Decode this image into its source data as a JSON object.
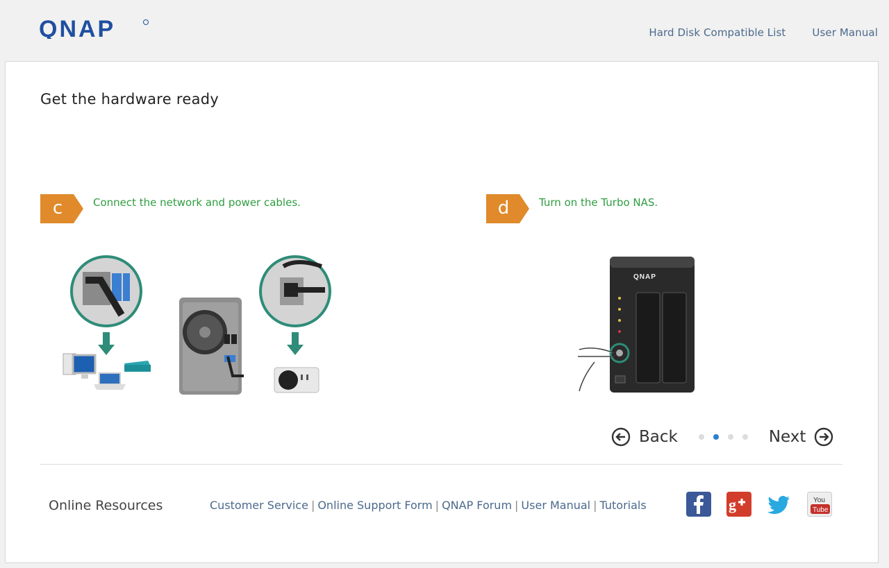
{
  "header": {
    "logo_text": "QNAP",
    "links": [
      "Hard Disk Compatible List",
      "User Manual"
    ]
  },
  "page": {
    "title": "Get the hardware ready"
  },
  "steps": [
    {
      "letter": "c",
      "text": "Connect the network and power cables."
    },
    {
      "letter": "d",
      "text": "Turn on the Turbo NAS."
    }
  ],
  "navigation": {
    "back_label": "Back",
    "next_label": "Next",
    "pages": 4,
    "active_page": 2
  },
  "footer": {
    "resources_title": "Online Resources",
    "links": [
      "Customer Service",
      "Online Support Form",
      "QNAP Forum",
      "User Manual",
      "Tutorials"
    ],
    "social": [
      "facebook-icon",
      "google-plus-icon",
      "twitter-icon",
      "youtube-icon"
    ]
  },
  "colors": {
    "accent_orange": "#e08a2b",
    "step_green": "#2f9d40",
    "link_blue": "#4b6a8c",
    "active_dot": "#2b7fce",
    "callout_teal": "#2e8c78"
  }
}
